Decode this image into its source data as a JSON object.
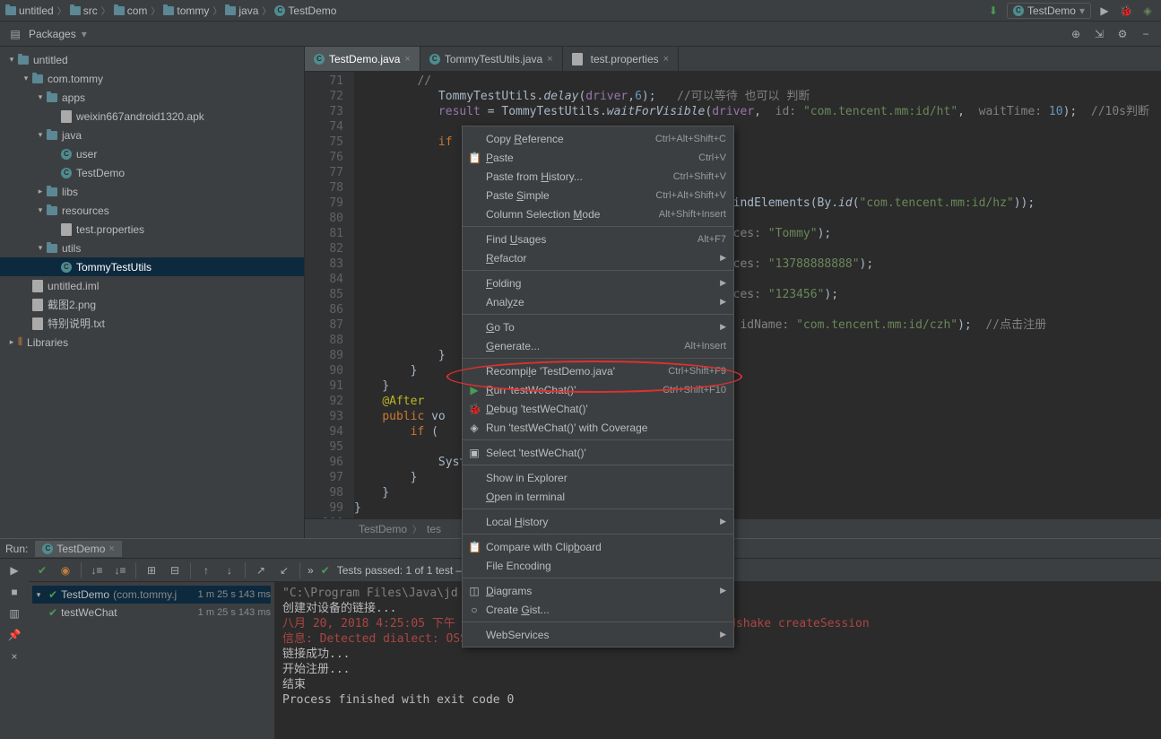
{
  "breadcrumb": [
    "untitled",
    "src",
    "com",
    "tommy",
    "java",
    "TestDemo"
  ],
  "runConfig": "TestDemo",
  "packagesLabel": "Packages",
  "tree": [
    {
      "depth": 0,
      "arrow": "▾",
      "icon": "folder",
      "label": "untitled"
    },
    {
      "depth": 1,
      "arrow": "▾",
      "icon": "folder",
      "label": "com.tommy"
    },
    {
      "depth": 2,
      "arrow": "▾",
      "icon": "folder",
      "label": "apps"
    },
    {
      "depth": 3,
      "arrow": "",
      "icon": "file",
      "label": "weixin667android1320.apk"
    },
    {
      "depth": 2,
      "arrow": "▾",
      "icon": "folder",
      "label": "java"
    },
    {
      "depth": 3,
      "arrow": "",
      "icon": "class",
      "label": "user"
    },
    {
      "depth": 3,
      "arrow": "",
      "icon": "class",
      "label": "TestDemo"
    },
    {
      "depth": 2,
      "arrow": "▸",
      "icon": "folder",
      "label": "libs"
    },
    {
      "depth": 2,
      "arrow": "▾",
      "icon": "folder",
      "label": "resources"
    },
    {
      "depth": 3,
      "arrow": "",
      "icon": "file",
      "label": "test.properties"
    },
    {
      "depth": 2,
      "arrow": "▾",
      "icon": "folder",
      "label": "utils"
    },
    {
      "depth": 3,
      "arrow": "",
      "icon": "class",
      "label": "TommyTestUtils",
      "selected": true
    },
    {
      "depth": 1,
      "arrow": "",
      "icon": "file",
      "label": "untitled.iml"
    },
    {
      "depth": 1,
      "arrow": "",
      "icon": "file",
      "label": "截图2.png"
    },
    {
      "depth": 1,
      "arrow": "",
      "icon": "file",
      "label": "特别说明.txt"
    },
    {
      "depth": 0,
      "arrow": "▸",
      "icon": "lib",
      "label": "Libraries"
    }
  ],
  "tabs": [
    {
      "label": "TestDemo.java",
      "icon": "class",
      "active": true
    },
    {
      "label": "TommyTestUtils.java",
      "icon": "class",
      "active": false
    },
    {
      "label": "test.properties",
      "icon": "file",
      "active": false
    }
  ],
  "gutterStart": 71,
  "gutterEnd": 100,
  "codeLines": [
    {
      "t": "//",
      "cls": "com",
      "indent": 3
    },
    {
      "html": "            TommyTestUtils.<span class='fn'>delay</span>(<span class='fld'>driver</span>,<span class='num'>6</span>);   <span class='com'>//可以等待 也可以 判断</span>"
    },
    {
      "html": "            <span class='fld'>result</span> = TommyTestUtils.<span class='fn'>waitForVisible</span>(<span class='fld'>driver</span>,  <span class='param'>id:</span> <span class='str'>\"com.tencent.mm:id/ht\"</span>,  <span class='param'>waitTime:</span> <span class='num'>10</span>);  <span class='com'>//10s判断</span>"
    },
    {
      "t": ""
    },
    {
      "html": "            <span class='kw'>if</span> (<span class='fld'>result</span>) {"
    },
    {
      "t": ""
    },
    {
      "t": ""
    },
    {
      "t": ""
    },
    {
      "html": "                                                    .findElements(By.<span class='fn'>id</span>(<span class='str'>\"com.tencent.mm:id/hz\"</span>));"
    },
    {
      "t": ""
    },
    {
      "html": "                                                    <span class='param'>ences:</span> <span class='str'>\"Tommy\"</span>);"
    },
    {
      "t": ""
    },
    {
      "html": "                                                    <span class='param'>ences:</span> <span class='str'>\"13788888888\"</span>);"
    },
    {
      "t": ""
    },
    {
      "html": "                                                    <span class='param'>ences:</span> <span class='str'>\"123456\"</span>);"
    },
    {
      "t": ""
    },
    {
      "html": "                                                    ,  <span class='param'>idName:</span> <span class='str'>\"com.tencent.mm:id/czh\"</span>);  <span class='com'>//点击注册</span>"
    },
    {
      "t": ""
    },
    {
      "t": "            }"
    },
    {
      "t": "        }"
    },
    {
      "t": "    }"
    },
    {
      "html": "    <span class='ann'>@After</span>"
    },
    {
      "html": "    <span class='kw'>public</span> vo"
    },
    {
      "html": "        <span class='kw'>if</span> ("
    },
    {
      "t": ""
    },
    {
      "t": "            Syst"
    },
    {
      "t": "        }"
    },
    {
      "t": "    }"
    },
    {
      "t": "}"
    },
    {
      "t": ""
    }
  ],
  "editorBreadcrumb": [
    "TestDemo",
    "tes"
  ],
  "contextMenu": [
    {
      "label": "Copy Reference",
      "shortcut": "Ctrl+Alt+Shift+C",
      "u": 5
    },
    {
      "label": "Paste",
      "shortcut": "Ctrl+V",
      "icon": "📋",
      "u": 0
    },
    {
      "label": "Paste from History...",
      "shortcut": "Ctrl+Shift+V",
      "u": 11
    },
    {
      "label": "Paste Simple",
      "shortcut": "Ctrl+Alt+Shift+V",
      "u": 6
    },
    {
      "label": "Column Selection Mode",
      "shortcut": "Alt+Shift+Insert",
      "u": 17
    },
    {
      "sep": true
    },
    {
      "label": "Find Usages",
      "shortcut": "Alt+F7",
      "u": 5
    },
    {
      "label": "Refactor",
      "arrow": true,
      "u": 0
    },
    {
      "sep": true
    },
    {
      "label": "Folding",
      "arrow": true,
      "u": 0
    },
    {
      "label": "Analyze",
      "arrow": true,
      "u": 4
    },
    {
      "sep": true
    },
    {
      "label": "Go To",
      "arrow": true,
      "u": 0
    },
    {
      "label": "Generate...",
      "shortcut": "Alt+Insert",
      "u": 0
    },
    {
      "sep": true
    },
    {
      "label": "Recompile 'TestDemo.java'",
      "shortcut": "Ctrl+Shift+F9",
      "u": 7
    },
    {
      "label": "Run 'testWeChat()'",
      "shortcut": "Ctrl+Shift+F10",
      "icon": "▶",
      "iconColor": "#499c54",
      "u": 0
    },
    {
      "label": "Debug 'testWeChat()'",
      "icon": "🐞",
      "u": 0
    },
    {
      "label": "Run 'testWeChat()' with Coverage",
      "icon": "◈"
    },
    {
      "sep": true
    },
    {
      "label": "Select 'testWeChat()'",
      "icon": "▣"
    },
    {
      "sep": true
    },
    {
      "label": "Show in Explorer"
    },
    {
      "label": "Open in terminal",
      "u": 0
    },
    {
      "sep": true
    },
    {
      "label": "Local History",
      "arrow": true,
      "u": 6
    },
    {
      "sep": true
    },
    {
      "label": "Compare with Clipboard",
      "icon": "📋",
      "u": 17
    },
    {
      "label": "File Encoding"
    },
    {
      "sep": true
    },
    {
      "label": "Diagrams",
      "arrow": true,
      "icon": "◫",
      "u": 0
    },
    {
      "label": "Create Gist...",
      "icon": "○",
      "u": 7
    },
    {
      "sep": true
    },
    {
      "label": "WebServices",
      "arrow": true
    }
  ],
  "runPanel": {
    "title": "Run:",
    "tab": "TestDemo",
    "testsStatus": "Tests passed: 1 of 1 test – 1 m 25",
    "treeItems": [
      {
        "label": "TestDemo",
        "hint": "(com.tommy.j",
        "time": "1 m 25 s 143 ms",
        "sel": true,
        "arrow": "▾"
      },
      {
        "label": "testWeChat",
        "time": "1 m 25 s 143 ms",
        "indent": 1
      }
    ],
    "console": [
      {
        "t": "\"C:\\Program Files\\Java\\jd",
        "cls": "rc-gray"
      },
      {
        "t": "创建对设备的链接...",
        "cls": ""
      },
      {
        "t": "八月 20, 2018 4:25:05 下午 org.openqa.selenium.remote.ProtocolHandshake createSession",
        "cls": "rc-red"
      },
      {
        "t": "信息: Detected dialect: OSS",
        "cls": "rc-red"
      },
      {
        "t": "链接成功...",
        "cls": ""
      },
      {
        "t": "开始注册...",
        "cls": ""
      },
      {
        "t": "结束",
        "cls": ""
      },
      {
        "t": "",
        "cls": ""
      },
      {
        "t": "Process finished with exit code 0",
        "cls": ""
      }
    ]
  }
}
